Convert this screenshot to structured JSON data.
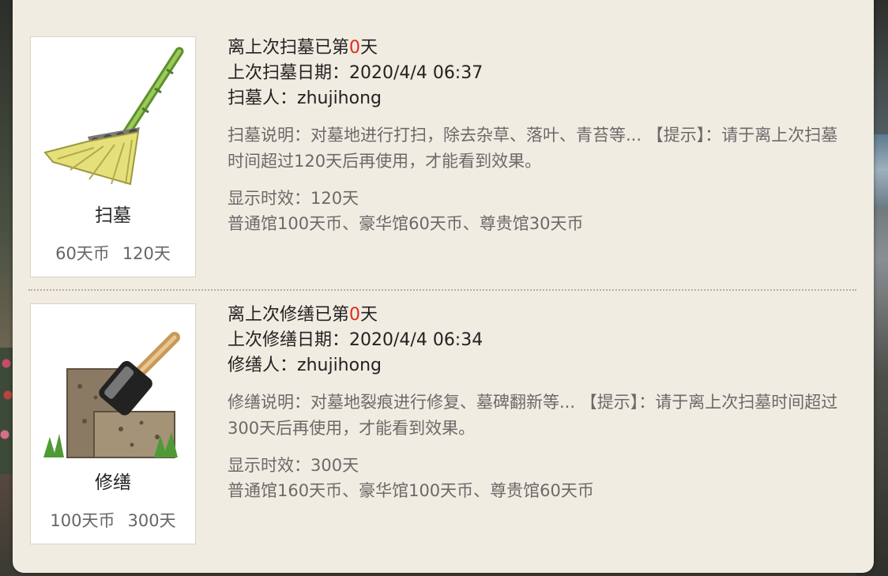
{
  "items": [
    {
      "name": "扫墓",
      "price": "60天币",
      "duration": "120天",
      "days_prefix": "离上次扫墓已第",
      "days_value": "0",
      "days_suffix": "天",
      "date_label": "上次扫墓日期：",
      "date_value": "2020/4/4 06:37",
      "person_label": "扫墓人：",
      "person_value": "zhujihong",
      "description": "扫墓说明：对墓地进行打扫，除去杂草、落叶、青苔等... 【提示】：请于离上次扫墓时间超过120天后再使用，才能看到效果。",
      "effect": "显示时效：120天",
      "halls": "普通馆100天币、豪华馆60天币、尊贵馆30天币"
    },
    {
      "name": "修缮",
      "price": "100天币",
      "duration": "300天",
      "days_prefix": "离上次修缮已第",
      "days_value": "0",
      "days_suffix": "天",
      "date_label": "上次修缮日期：",
      "date_value": "2020/4/4 06:34",
      "person_label": "修缮人：",
      "person_value": "zhujihong",
      "description": "修缮说明：对墓地裂痕进行修复、墓碑翻新等... 【提示】：请于离上次扫墓时间超过300天后再使用，才能看到效果。",
      "effect": "显示时效：300天",
      "halls": "普通馆160天币、豪华馆100天币、尊贵馆60天币"
    }
  ],
  "icons": {
    "item0": "broom-icon",
    "item1": "hammer-brick-icon"
  },
  "colors": {
    "panel": "#f1ece1",
    "highlight": "#e02a1c",
    "muted": "#6a6a6a"
  }
}
